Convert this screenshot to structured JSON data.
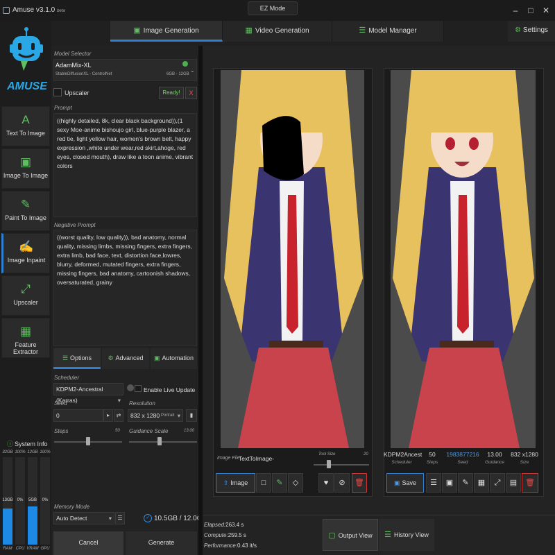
{
  "app": {
    "title": "Amuse v3.1.0",
    "beta": "beta",
    "ez_mode": "EZ Mode",
    "logo_text": "AMUSE"
  },
  "tabs": [
    {
      "label": "Image Generation",
      "icon": "image-icon",
      "active": true
    },
    {
      "label": "Video Generation",
      "icon": "film-icon",
      "active": false
    },
    {
      "label": "Model Manager",
      "icon": "layers-icon",
      "active": false
    }
  ],
  "settings": {
    "label": "Settings",
    "icon": "gear-icon"
  },
  "nav": [
    {
      "label": "Text To Image",
      "icon": "A",
      "active": false
    },
    {
      "label": "Image To Image",
      "icon": "image-icon",
      "active": false
    },
    {
      "label": "Paint To Image",
      "icon": "brush-icon",
      "active": false
    },
    {
      "label": "Image Inpaint",
      "icon": "edit-icon",
      "active": true
    },
    {
      "label": "Upscaler",
      "icon": "expand-icon",
      "active": false
    },
    {
      "label": "Feature Extractor",
      "icon": "feature-icon",
      "active": false
    }
  ],
  "system_info": {
    "label": "System Info",
    "gauges": [
      {
        "top": "32GB",
        "mid": "13GB",
        "bottom": "RAM",
        "level": 0.41
      },
      {
        "top": "100%",
        "mid": "0%",
        "bottom": "CPU",
        "level": 0.0
      },
      {
        "top": "12GB",
        "mid": "5GB",
        "bottom": "VRAM",
        "level": 0.44
      },
      {
        "top": "100%",
        "mid": "0%",
        "bottom": "GPU",
        "level": 0.0
      }
    ]
  },
  "model": {
    "label": "Model Selector",
    "name": "AdamMix-XL",
    "sub": "StableDiffusionXL - ControlNet",
    "vram": "6GB - 12GB",
    "upscaler_label": "Upscaler",
    "ready": "Ready!",
    "ready_x": "X"
  },
  "prompt": {
    "label": "Prompt",
    "text": "((highly detailed, 8k, clear black background)),(1 sexy Moe-anime bishoujo girl, blue-purple blazer, a red tie, light yellow hair, women's brown belt, happy expression ,white under wear,red skirt,ahoge, red eyes, closed mouth), draw like a toon anime, vibrant colors"
  },
  "negative_prompt": {
    "label": "Negative Prompt",
    "text": "((worst quality, low quality)), bad anatomy, normal quality, missing limbs, missing fingers, extra fingers, extra limb, bad face, text, distortion face,lowres, blurry, deformed, mutated fingers, extra fingers, missing fingers, bad anatomy, cartoonish shadows, oversaturated, grainy"
  },
  "option_tabs": [
    {
      "label": "Options",
      "active": true
    },
    {
      "label": "Advanced",
      "active": false
    },
    {
      "label": "Automation",
      "active": false
    }
  ],
  "options": {
    "scheduler_label": "Scheduler",
    "scheduler": "KDPM2-Ancestral (Karras)",
    "live_update": "Enable Live Update",
    "seed_label": "Seed",
    "seed": "0",
    "resolution_label": "Resolution",
    "resolution": "832 x 1280",
    "orientation": "Portrait",
    "steps_label": "Steps",
    "steps": "50",
    "steps_level": 0.5,
    "guidance_label": "Guidance Scale",
    "guidance": "13.00",
    "guidance_level": 0.45,
    "memory_label": "Memory Mode",
    "memory": "Auto Detect",
    "vram_total": "10.5GB / 12.0GB"
  },
  "actions": {
    "cancel": "Cancel",
    "generate": "Generate"
  },
  "input_panel": {
    "file_label": "Image File:",
    "file_value": "TextToImage-",
    "tool_size_label": "Tool Size",
    "tool_size_max": "20",
    "image_button": "Image"
  },
  "output_panel": {
    "info": [
      {
        "value": "KDPM2Ancest",
        "label": "Scheduler"
      },
      {
        "value": "50",
        "label": "Steps"
      },
      {
        "value": "1983877216",
        "label": "Seed"
      },
      {
        "value": "13.00",
        "label": "Guidance"
      },
      {
        "value": "832 x1280",
        "label": "Size"
      }
    ],
    "save": "Save"
  },
  "stats": {
    "elapsed_label": "Elapsed:",
    "elapsed": "263.4 s",
    "compute_label": "Compute:",
    "compute": "259.5 s",
    "performance_label": "Performance:",
    "performance": "0.43 it/s"
  },
  "views": {
    "output": "Output View",
    "history": "History View"
  },
  "colors": {
    "accent": "#2f7fd3",
    "icon_green": "#5fbf60",
    "danger": "#e24c4c",
    "ready": "#7bd36c"
  }
}
